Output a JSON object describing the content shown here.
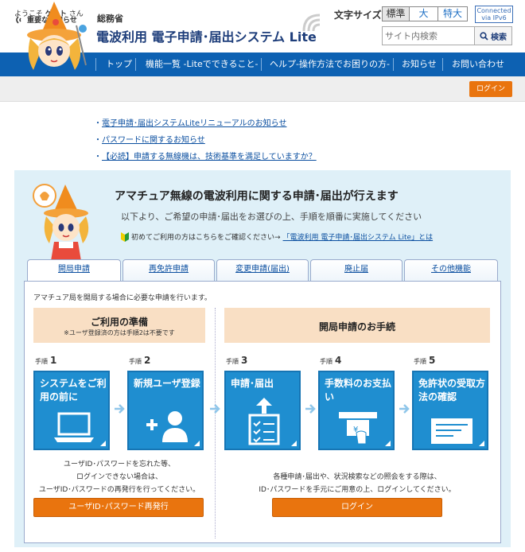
{
  "header": {
    "ministry": "総務省",
    "title": "電波利用 電子申請･届出システム Lite",
    "fontsize_label": "文字サイズ",
    "fontsize_options": [
      "標準",
      "大",
      "特大"
    ],
    "ipv6_line1": "Connected",
    "ipv6_line2": "via IPv6",
    "search_placeholder": "サイト内検索",
    "search_button": "検索"
  },
  "nav": [
    "トップ",
    "機能一覧 -Liteでできること-",
    "ヘルプ-操作方法でお困りの方-",
    "お知らせ",
    "お問い合わせ"
  ],
  "welcome": {
    "prefix": "ようこそ",
    "user": "ゲスト",
    "suffix": "さん",
    "login": "ログイン"
  },
  "notice": {
    "label": "重要なお知らせ",
    "items": [
      "電子申請･届出システムLiteリニューアルのお知らせ",
      "パスワードに関するお知らせ",
      "【必読】申請する無線機は、技術基準を満足していますか？"
    ]
  },
  "lead": {
    "title": "アマチュア無線の電波利用に関する申請･届出が行えます",
    "sub": "以下より、ご希望の申請･届出をお選びの上、手順を順番に実施してください",
    "first_time_text": "初めてご利用の方はこちらをご確認ください→",
    "first_time_link": "「電波利用 電子申請･届出システム Lite」とは"
  },
  "tabs": [
    "開局申請",
    "再免許申請",
    "変更申請(届出)",
    "廃止届",
    "その他機能"
  ],
  "tab_desc": "アマチュア局を開局する場合に必要な申請を行います。",
  "prep": {
    "title": "ご利用の準備",
    "note": "※ユーザ登録済の方は手順2は不要です"
  },
  "proc": {
    "title": "開局申請のお手続"
  },
  "steps": [
    {
      "label": "手順",
      "num": "1",
      "caption": "システムをご利用の前に"
    },
    {
      "label": "手順",
      "num": "2",
      "caption": "新規ユーザ登録"
    },
    {
      "label": "手順",
      "num": "3",
      "caption": "申請･届出"
    },
    {
      "label": "手順",
      "num": "4",
      "caption": "手数料のお支払い"
    },
    {
      "label": "手順",
      "num": "5",
      "caption": "免許状の受取方法の確認"
    }
  ],
  "left_info": [
    "ユーザID･パスワードを忘れた等、",
    "ログインできない場合は、",
    "ユーザID･パスワードの再発行を行ってください。"
  ],
  "right_info": [
    "各種申請･届出や、状況検索などの照会をする際は、",
    "ID･パスワードを手元にご用意の上、ログインしてください。"
  ],
  "buttons": {
    "reissue": "ユーザID･パスワード再発行",
    "login": "ログイン"
  },
  "colors": {
    "nav": "#0d61b2",
    "accent": "#e9740e",
    "card": "#1f8ed0",
    "panel": "#dff0f8",
    "peach": "#f9dfc4"
  }
}
